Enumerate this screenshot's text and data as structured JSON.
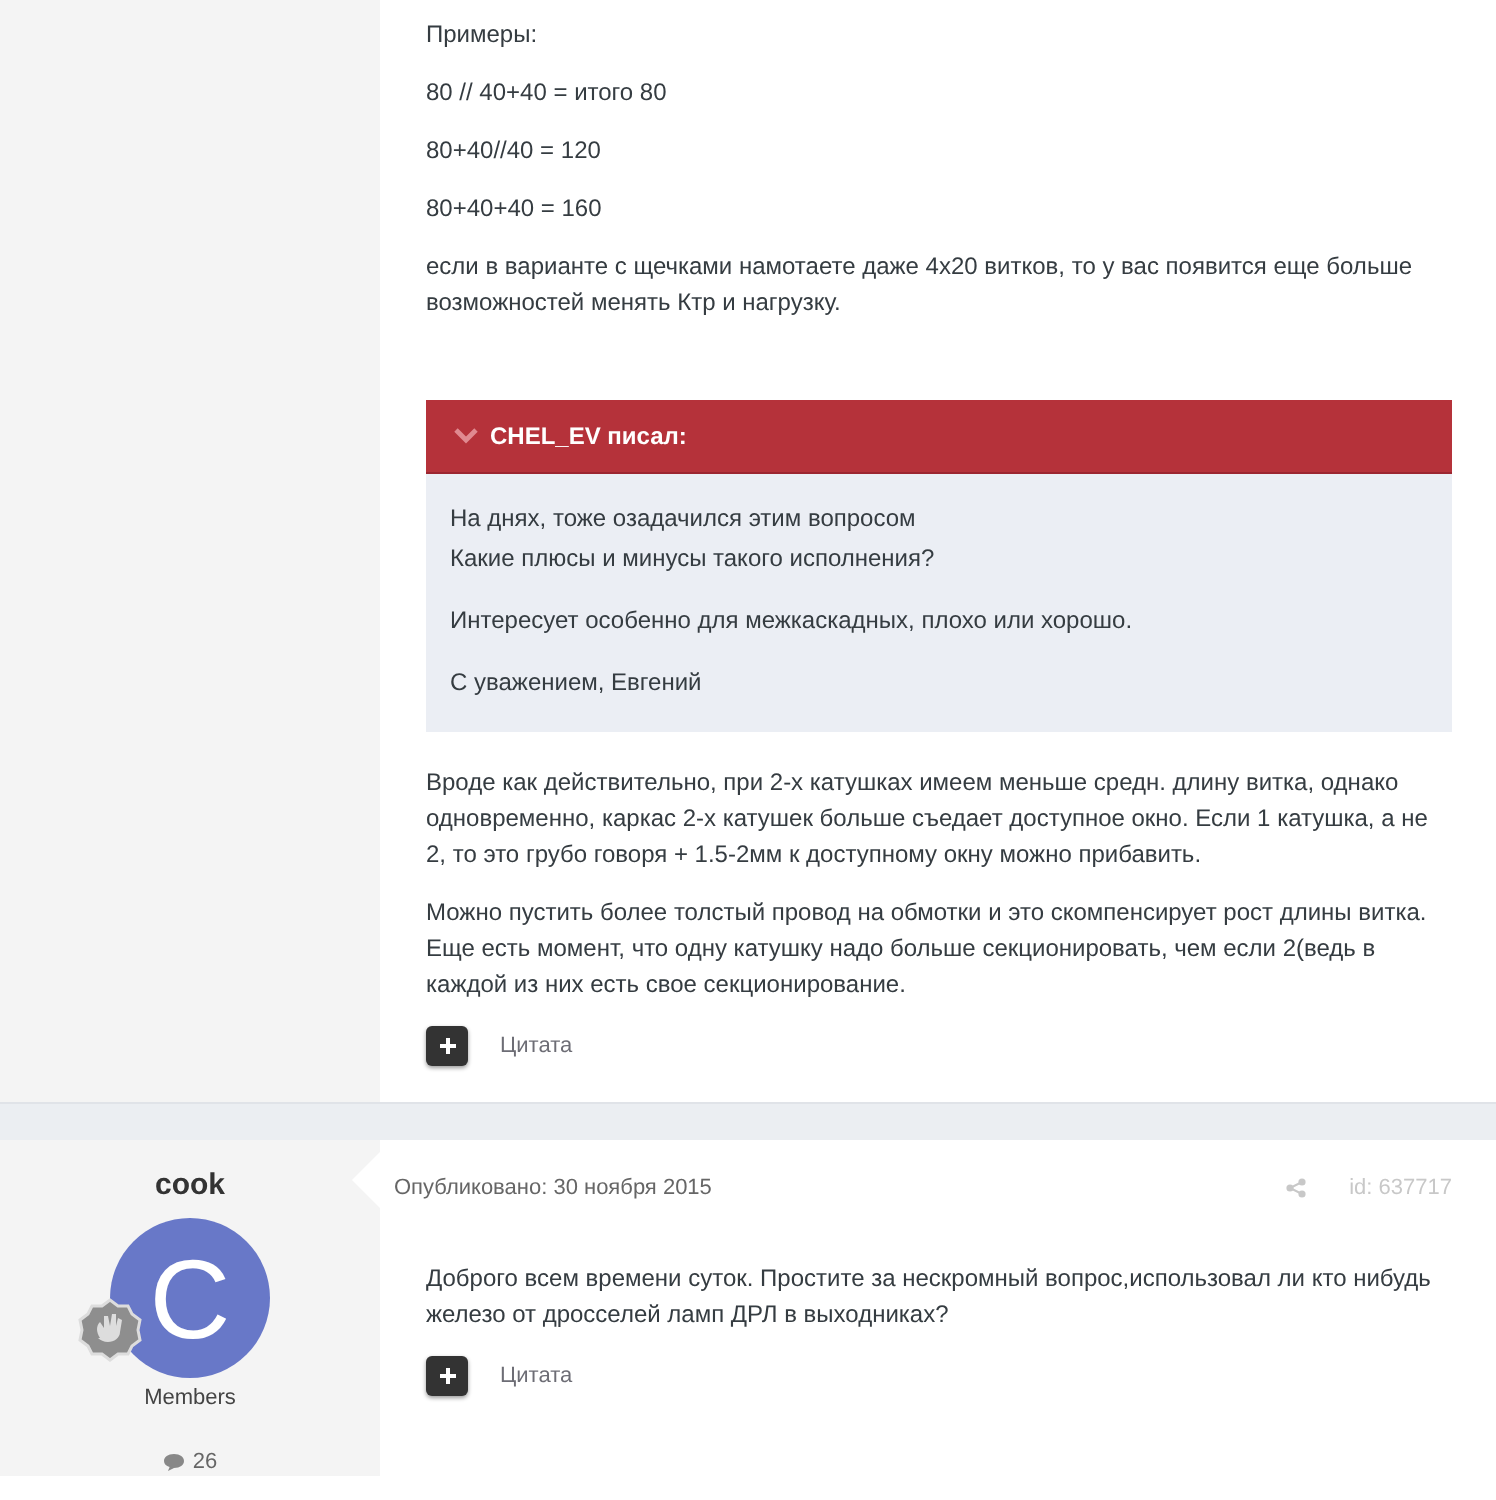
{
  "posts": [
    {
      "paragraphs": [
        "Примеры:",
        "80 // 40+40 = итого 80",
        "80+40//40 = 120",
        "80+40+40 = 160",
        "если в варианте с щечками намотаете даже 4х20 витков, то у вас появится еще больше возможностей менять Ктр и нагрузку."
      ],
      "quote": {
        "author": "CHEL_EV писал:",
        "paragraphs": [
          [
            "На днях, тоже озадачился этим вопросом",
            "Какие плюсы и минусы такого исполнения?"
          ],
          [
            "Интересует особенно для межкаскадных, плохо или хорошо."
          ],
          [
            "С уважением, Евгений"
          ]
        ]
      },
      "after_quote": [
        "Вроде как действительно, при 2-х катушках имеем меньше средн. длину витка, однако одновременно, каркас 2-х катушек больше съедает доступное окно. Если 1 катушка, а не 2, то это грубо говоря + 1.5-2мм к доступному окну можно прибавить.",
        "Можно пустить более толстый провод на обмотки и это скомпенсирует рост длины витка. Еще есть момент, что одну катушку надо больше секционировать, чем если 2(ведь в каждой из них есть свое секционирование."
      ],
      "cite_label": "Цитата"
    },
    {
      "author": {
        "name": "cook",
        "avatar_letter": "C",
        "group": "Members",
        "post_count": "26"
      },
      "published": "Опубликовано: 30 ноября 2015",
      "post_id": "id: 637717",
      "paragraphs": [
        "Доброго всем времени суток. Простите за нескромный вопрос,использовал ли кто нибудь железо от дросселей ламп ДРЛ в выходниках?"
      ],
      "cite_label": "Цитата"
    }
  ]
}
